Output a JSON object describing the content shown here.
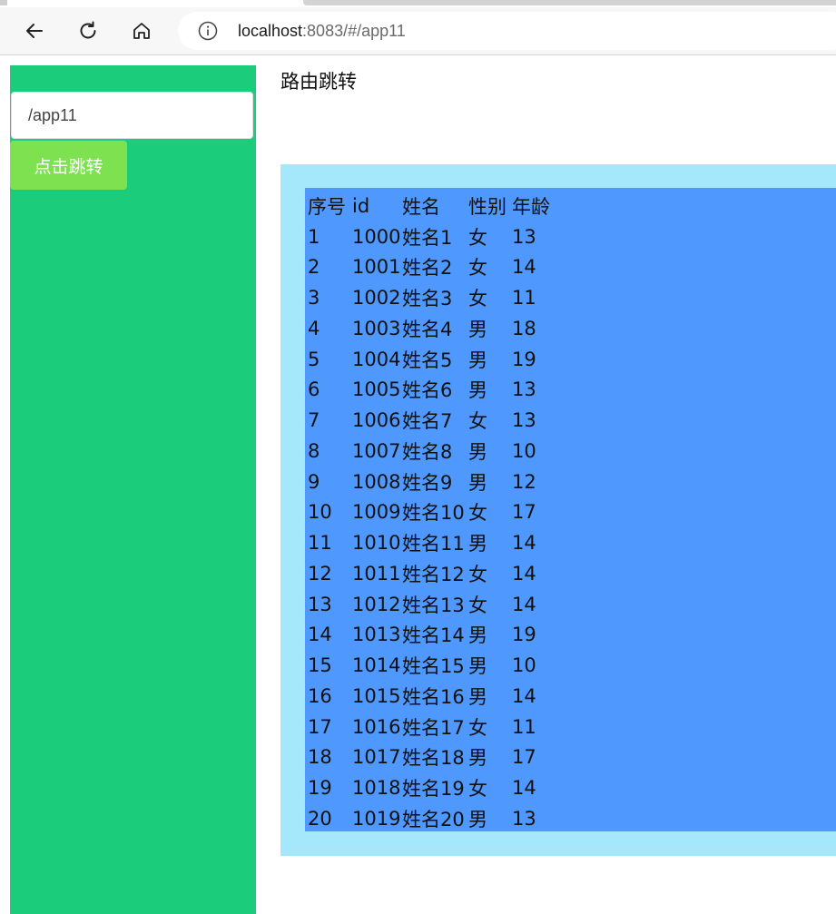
{
  "browser": {
    "url_host": "localhost",
    "url_rest": ":8083/#/app11"
  },
  "sidebar": {
    "route_input_value": "/app11",
    "jump_button_label": "点击跳转"
  },
  "main": {
    "title": "路由跳转"
  },
  "table": {
    "headers": [
      "序号",
      "id",
      "姓名",
      "性别",
      "年龄"
    ],
    "rows": [
      [
        "1",
        "1000",
        "姓名1",
        "女",
        "13"
      ],
      [
        "2",
        "1001",
        "姓名2",
        "女",
        "14"
      ],
      [
        "3",
        "1002",
        "姓名3",
        "女",
        "11"
      ],
      [
        "4",
        "1003",
        "姓名4",
        "男",
        "18"
      ],
      [
        "5",
        "1004",
        "姓名5",
        "男",
        "19"
      ],
      [
        "6",
        "1005",
        "姓名6",
        "男",
        "13"
      ],
      [
        "7",
        "1006",
        "姓名7",
        "女",
        "13"
      ],
      [
        "8",
        "1007",
        "姓名8",
        "男",
        "10"
      ],
      [
        "9",
        "1008",
        "姓名9",
        "男",
        "12"
      ],
      [
        "10",
        "1009",
        "姓名10",
        "女",
        "17"
      ],
      [
        "11",
        "1010",
        "姓名11",
        "男",
        "14"
      ],
      [
        "12",
        "1011",
        "姓名12",
        "女",
        "14"
      ],
      [
        "13",
        "1012",
        "姓名13",
        "女",
        "14"
      ],
      [
        "14",
        "1013",
        "姓名14",
        "男",
        "19"
      ],
      [
        "15",
        "1014",
        "姓名15",
        "男",
        "10"
      ],
      [
        "16",
        "1015",
        "姓名16",
        "男",
        "14"
      ],
      [
        "17",
        "1016",
        "姓名17",
        "女",
        "11"
      ],
      [
        "18",
        "1017",
        "姓名18",
        "男",
        "17"
      ],
      [
        "19",
        "1018",
        "姓名19",
        "女",
        "14"
      ],
      [
        "20",
        "1019",
        "姓名20",
        "男",
        "13"
      ]
    ]
  },
  "colors": {
    "sidebar_bg": "#1bcc7a",
    "button_bg": "#7ee250",
    "table_panel_bg": "#a6e8fb",
    "table_bg": "#4f98fe"
  },
  "icons": {
    "back": "back-arrow-icon",
    "reload": "reload-icon",
    "home": "home-icon",
    "info": "info-icon"
  }
}
